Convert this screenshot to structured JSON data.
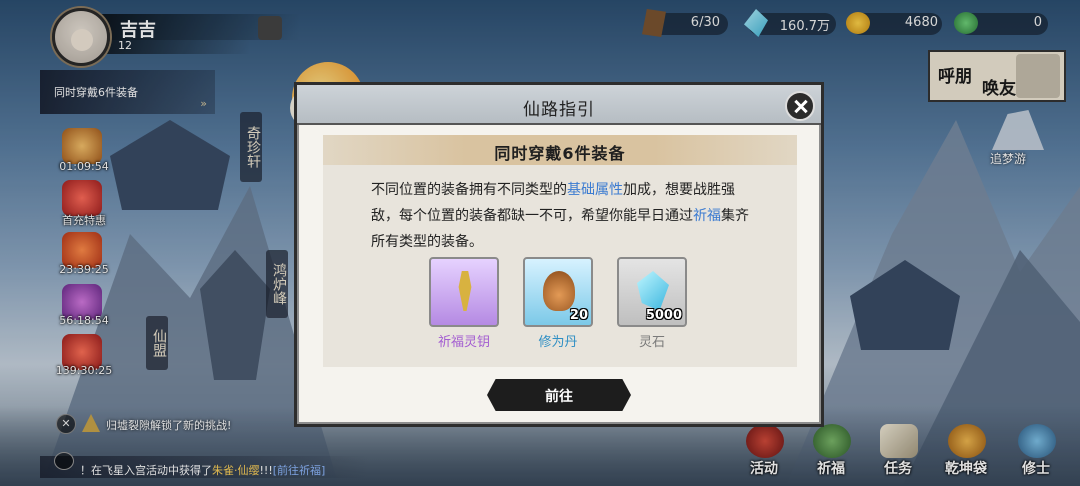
{
  "player": {
    "name": "吉吉",
    "level": "12"
  },
  "resources": [
    {
      "icon": "wood-plank-icon",
      "value": "6/30"
    },
    {
      "icon": "crystal-icon",
      "value": "160.7万"
    },
    {
      "icon": "gold-ingot-icon",
      "value": "4680"
    },
    {
      "icon": "jade-icon",
      "value": "0"
    }
  ],
  "friend_call": {
    "label_1": "呼朋",
    "label_2": "唤友"
  },
  "dream": {
    "label": "追梦游"
  },
  "quest": {
    "text": "同时穿戴6件装备",
    "arrow": "»"
  },
  "events": [
    {
      "label": "01:09:54"
    },
    {
      "label": "首充特惠"
    },
    {
      "label": "23:39:25"
    },
    {
      "label": "56:18:54"
    },
    {
      "label": "139:30:25"
    }
  ],
  "locations": {
    "zhenxuan": "奇珍轩",
    "honglu": "鸿炉峰",
    "xianmeng": "仙盟"
  },
  "notice": {
    "btn": "✕",
    "text": "归墟裂隙解锁了新的挑战!"
  },
  "chat": {
    "prefix": "！在飞星入宫活动中获得了",
    "item": "朱雀·仙缨",
    "suffix": "!!!",
    "link": "[前往祈福]"
  },
  "nav": [
    {
      "label": "活动",
      "icon": "drum-icon"
    },
    {
      "label": "祈福",
      "icon": "blessing-icon"
    },
    {
      "label": "任务",
      "icon": "scroll-icon"
    },
    {
      "label": "乾坤袋",
      "icon": "bag-icon"
    },
    {
      "label": "修士",
      "icon": "cultivator-icon"
    }
  ],
  "dialog": {
    "title": "仙路指引",
    "heading": "同时穿戴6件装备",
    "desc": {
      "p1": "不同位置的装备拥有不同类型的",
      "h1": "基础属性",
      "p2": "加成，想要战胜强敌，每个位置的装备都缺一不可，希望你能早日通过",
      "h2": "祈福",
      "p3": "集齐所有类型的装备。"
    },
    "rewards": [
      {
        "name": "祈福灵钥",
        "qty": "",
        "icon": "key-icon",
        "color": "#a35dd1"
      },
      {
        "name": "修为丹",
        "qty": "20",
        "icon": "gourd-icon",
        "color": "#2f8fc4"
      },
      {
        "name": "灵石",
        "qty": "5000",
        "icon": "spirit-stone-icon",
        "color": "#7a7a7a"
      }
    ],
    "go_button": "前往"
  }
}
